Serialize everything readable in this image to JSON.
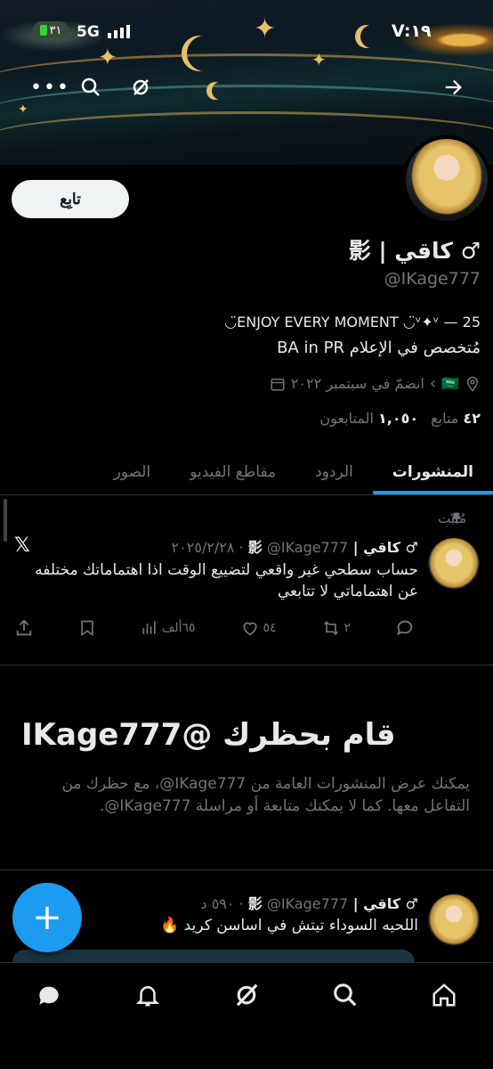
{
  "status_bar": {
    "time": "V:١٩",
    "network": "5G",
    "battery": "٣١"
  },
  "profile": {
    "follow_label": "تابِع",
    "display_name": "♂ كاقي | 影",
    "handle": "@IKage777",
    "bio_line1": "25 — ENJOY EVERY MOMENT ◡̈ᵛ✦ᵛ◡̈",
    "bio_line2": "مُتخصص في الإعلام BA in PR",
    "flag": "🇸🇦",
    "joined": "انضمّ في سبتمبر ٢٠٢٢",
    "following_count": "٤٢",
    "following_label": "متابع",
    "followers_count": "١,٠٥٠",
    "followers_label": "المتابعون"
  },
  "tabs": [
    {
      "label": "المنشورات",
      "active": true
    },
    {
      "label": "الردود",
      "active": false
    },
    {
      "label": "مقاطع الفيديو",
      "active": false
    },
    {
      "label": "الصور",
      "active": false
    }
  ],
  "pinned_post": {
    "pinned_label": "مُثبّت",
    "author": "♂ كاقي | 影",
    "meta": "@IKage777 · ٢٠٢٥/٢/٢٨",
    "text": "حساب سطحي غير واقعي لتضييع الوقت اذا اهتماماتك مختلفه عن اهتماماتي لا تتابعي",
    "retweets": "٢",
    "likes": "٥٤",
    "views": "٦٥ألف"
  },
  "block_notice": {
    "title": "قام بحظرك @IKage777",
    "body": "يمكنك عرض المنشورات العامة من ‎@IKage777، مع حظرك من التفاعل معها. كما لا يمكنك متابعة أو مراسلة ‎@IKage777."
  },
  "second_post": {
    "author": "♂ كاقي | 影",
    "meta": "@IKage777 · ٥٩٠ د",
    "text": "اللحيه السوداء تيتش في اساسن كريد 🔥"
  },
  "colors": {
    "accent": "#1d9bf0",
    "background": "#000000",
    "muted": "#71767b"
  }
}
